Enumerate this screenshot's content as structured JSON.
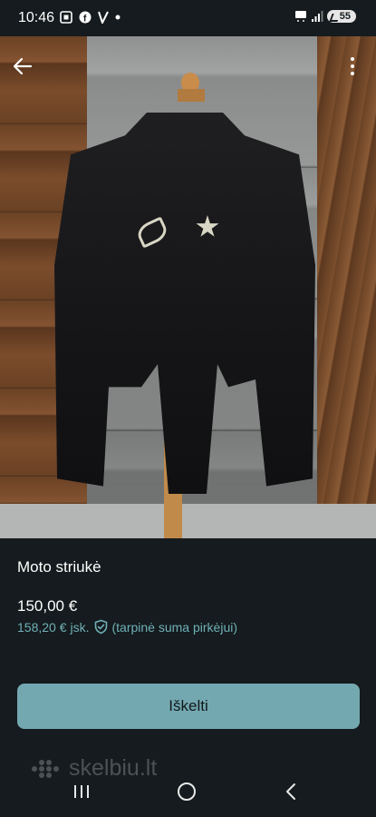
{
  "status_bar": {
    "time": "10:46",
    "left_icons": [
      "screenshot-icon",
      "facebook-icon",
      "v-app-icon",
      "notification-dot-icon"
    ],
    "right_icons": [
      "5g-icon",
      "signal-icon"
    ],
    "battery": "55"
  },
  "top_bar": {
    "back_icon": "arrow-left-icon",
    "more_icon": "more-vertical-icon"
  },
  "gallery": {
    "dots_total": 5,
    "active_index": 0
  },
  "listing": {
    "title": "Moto striukė",
    "price": "150,00 €",
    "total_price": "158,20 €",
    "total_suffix": "jsk.",
    "total_note": "(tarpinė suma pirkėjui)"
  },
  "cta": {
    "label": "Iškelti"
  },
  "brand": {
    "name": "skelbiu.lt"
  },
  "colors": {
    "background": "#151b1e",
    "accent": "#74a8b0",
    "accent_text": "#6fb0b7"
  }
}
